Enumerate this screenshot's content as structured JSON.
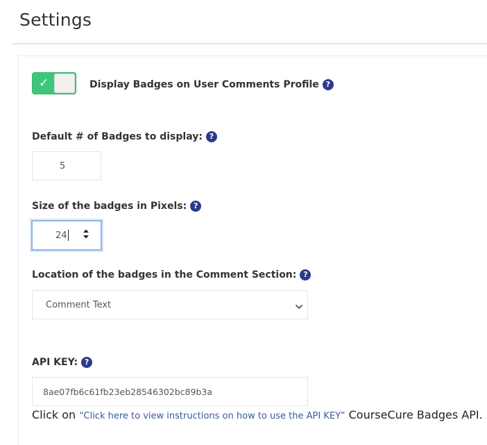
{
  "page": {
    "title": "Settings"
  },
  "settings": {
    "display_badges": {
      "label": "Display Badges on User Comments Profile",
      "enabled": true,
      "help": "?"
    },
    "default_badges": {
      "label": "Default # of Badges to display:",
      "value": "5",
      "help": "?"
    },
    "badge_size": {
      "label": "Size of the badges in Pixels:",
      "value": "24",
      "help": "?"
    },
    "badge_location": {
      "label": "Location of the badges in the Comment Section:",
      "selected": "Comment Text",
      "help": "?"
    },
    "api_key": {
      "label": "API KEY:",
      "value": "8ae07fb6c61fb23eb28546302bc89b3a",
      "help": "?"
    }
  },
  "footer_line": {
    "prefix": "Click on ",
    "link_text": "“Click here to view instructions on how to use the API KEY”",
    "suffix": " CourseCure Badges API."
  },
  "colors": {
    "toggle_on": "#3ec77c",
    "help_icon": "#2d3a8c",
    "link": "#3a5a9a",
    "focus_border": "#8fb4e8"
  },
  "icons": {
    "toggle_check": "check-icon",
    "help": "question-circle-icon",
    "spinner": "spinner-arrows-icon",
    "dropdown": "chevron-down-icon"
  }
}
